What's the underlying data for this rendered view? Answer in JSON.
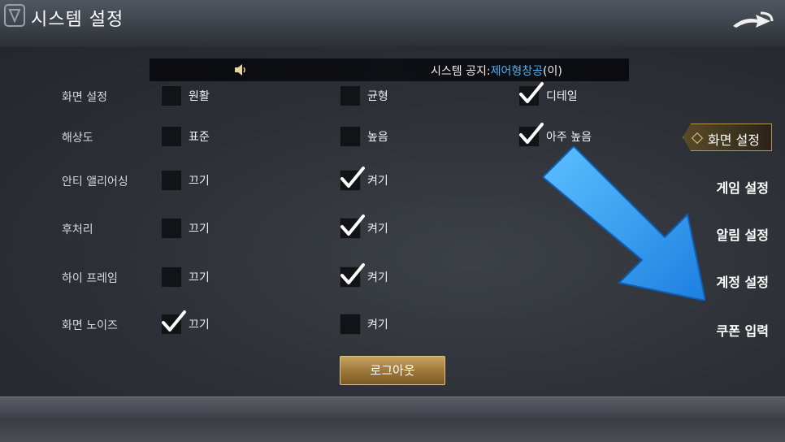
{
  "header": {
    "title": "시스템 설정"
  },
  "notice": {
    "prefix": "시스템 공지:",
    "highlight": "제어형창공",
    "suffix": "(이)"
  },
  "rows": [
    {
      "label": "화면 설정",
      "options": [
        {
          "text": "원활",
          "checked": false
        },
        {
          "text": "균형",
          "checked": false
        },
        {
          "text": "디테일",
          "checked": true
        }
      ]
    },
    {
      "label": "해상도",
      "options": [
        {
          "text": "표준",
          "checked": false
        },
        {
          "text": "높음",
          "checked": false
        },
        {
          "text": "아주 높음",
          "checked": true
        }
      ]
    },
    {
      "label": "안티 앨리어싱",
      "options": [
        {
          "text": "끄기",
          "checked": false
        },
        {
          "text": "켜기",
          "checked": true
        }
      ]
    },
    {
      "label": "후처리",
      "options": [
        {
          "text": "끄기",
          "checked": false
        },
        {
          "text": "켜기",
          "checked": true
        }
      ]
    },
    {
      "label": "하이 프레임",
      "options": [
        {
          "text": "끄기",
          "checked": false
        },
        {
          "text": "켜기",
          "checked": true
        }
      ]
    },
    {
      "label": "화면 노이즈",
      "options": [
        {
          "text": "끄기",
          "checked": true
        },
        {
          "text": "켜기",
          "checked": false
        }
      ]
    }
  ],
  "sidebar": {
    "active": "화면 설정",
    "items": [
      "게임 설정",
      "알림 설정",
      "계정 설정",
      "쿠폰 입력"
    ]
  },
  "logout_label": "로그아웃",
  "colors": {
    "accent": "#b9934a",
    "notice_highlight": "#4ab4ff",
    "arrow": "#3aa0f0"
  }
}
